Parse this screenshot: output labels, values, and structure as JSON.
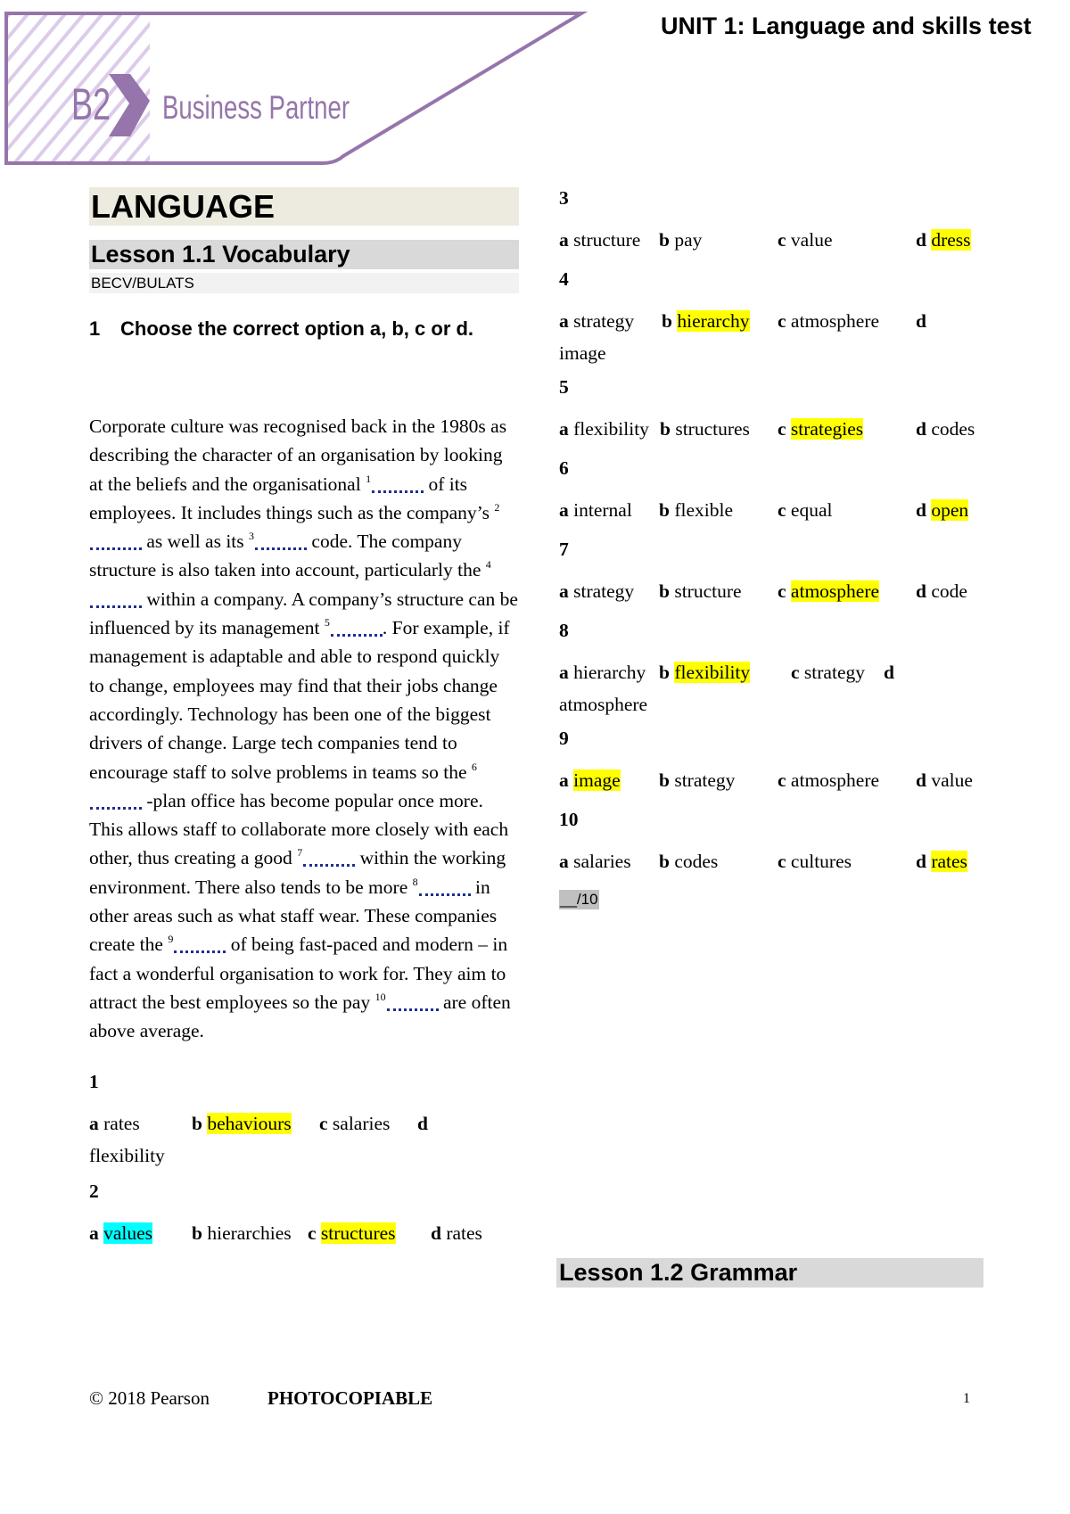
{
  "header": {
    "logo_level": "B2",
    "logo_title": "Business Partner",
    "unit_title": "UNIT 1: Language and skills test",
    "brand_color": "#9575ab",
    "stripe_color": "#dcccea"
  },
  "section": {
    "title": "LANGUAGE",
    "lesson_title": "Lesson 1.1 Vocabulary",
    "exam_tag": "BECV/BULATS",
    "exercise_number": "1",
    "instruction": "Choose the correct option a, b, c or d."
  },
  "passage": {
    "segments": [
      {
        "text": "Corporate culture was recognised back in the 1980s as describing the character of an organisation by looking at the beliefs and the organisational "
      },
      {
        "gap": "1"
      },
      {
        "text": " of its employees. It includes things such as the company’s "
      },
      {
        "gap": "2"
      },
      {
        "text": " as well as its "
      },
      {
        "gap": "3"
      },
      {
        "text": " code. The company structure is also taken into account, particularly the "
      },
      {
        "gap": "4"
      },
      {
        "text": " within a company. A company’s structure can be influenced by its management "
      },
      {
        "gap": "5"
      },
      {
        "text": ". For example, if management is adaptable and able to respond quickly to change, employees may find that their jobs change accordingly. Technology has been one of the biggest drivers of change. Large tech companies tend to encourage staff to solve problems in teams so the "
      },
      {
        "gap": "6"
      },
      {
        "text": " -plan office has become popular once more. This allows staff to collaborate more closely with each other, thus creating a good "
      },
      {
        "gap": "7"
      },
      {
        "text": " within the working environment. There also tends to be more "
      },
      {
        "gap": "8"
      },
      {
        "text": " in other areas such as what staff wear. These companies create the "
      },
      {
        "gap": "9"
      },
      {
        "text": " of being fast-paced and modern – in fact a wonderful organisation to work for. They aim to attract the best employees so the pay "
      },
      {
        "gap": "10"
      },
      {
        "text": " are often above average."
      }
    ]
  },
  "questions": [
    {
      "number": "1",
      "options": [
        {
          "letter": "a",
          "text": "rates",
          "highlight": ""
        },
        {
          "letter": "b",
          "text": "behaviours",
          "highlight": "yellow"
        },
        {
          "letter": "c",
          "text": "salaries",
          "highlight": ""
        },
        {
          "letter": "d",
          "text": "flexibility",
          "highlight": ""
        }
      ]
    },
    {
      "number": "2",
      "options": [
        {
          "letter": "a",
          "text": "values",
          "highlight": "cyan"
        },
        {
          "letter": "b",
          "text": "hierarchies",
          "highlight": ""
        },
        {
          "letter": "c",
          "text": "structures",
          "highlight": "yellow"
        },
        {
          "letter": "d",
          "text": "rates",
          "highlight": ""
        }
      ]
    },
    {
      "number": "3",
      "options": [
        {
          "letter": "a",
          "text": "structure",
          "highlight": ""
        },
        {
          "letter": "b",
          "text": "pay",
          "highlight": ""
        },
        {
          "letter": "c",
          "text": "value",
          "highlight": ""
        },
        {
          "letter": "d",
          "text": "dress",
          "highlight": "yellow"
        }
      ]
    },
    {
      "number": "4",
      "options": [
        {
          "letter": "a",
          "text": "strategy",
          "highlight": ""
        },
        {
          "letter": "b",
          "text": "hierarchy",
          "highlight": "yellow"
        },
        {
          "letter": "c",
          "text": "atmosphere",
          "highlight": ""
        },
        {
          "letter": "d",
          "text": "image",
          "highlight": ""
        }
      ]
    },
    {
      "number": "5",
      "options": [
        {
          "letter": "a",
          "text": "flexibility",
          "highlight": ""
        },
        {
          "letter": "b",
          "text": "structures",
          "highlight": ""
        },
        {
          "letter": "c",
          "text": "strategies",
          "highlight": "yellow"
        },
        {
          "letter": "d",
          "text": "codes",
          "highlight": ""
        }
      ]
    },
    {
      "number": "6",
      "options": [
        {
          "letter": "a",
          "text": "internal",
          "highlight": ""
        },
        {
          "letter": "b",
          "text": "flexible",
          "highlight": ""
        },
        {
          "letter": "c",
          "text": "equal",
          "highlight": ""
        },
        {
          "letter": "d",
          "text": "open",
          "highlight": "yellow"
        }
      ]
    },
    {
      "number": "7",
      "options": [
        {
          "letter": "a",
          "text": "strategy",
          "highlight": ""
        },
        {
          "letter": "b",
          "text": "structure",
          "highlight": ""
        },
        {
          "letter": "c",
          "text": "atmosphere",
          "highlight": "yellow"
        },
        {
          "letter": "d",
          "text": "code",
          "highlight": ""
        }
      ]
    },
    {
      "number": "8",
      "options": [
        {
          "letter": "a",
          "text": "hierarchy",
          "highlight": ""
        },
        {
          "letter": "b",
          "text": "flexibility",
          "highlight": "yellow"
        },
        {
          "letter": "c",
          "text": "strategy",
          "highlight": ""
        },
        {
          "letter": "d",
          "text": "atmosphere",
          "highlight": ""
        }
      ]
    },
    {
      "number": "9",
      "options": [
        {
          "letter": "a",
          "text": "image",
          "highlight": "yellow"
        },
        {
          "letter": "b",
          "text": "strategy",
          "highlight": ""
        },
        {
          "letter": "c",
          "text": "atmosphere",
          "highlight": ""
        },
        {
          "letter": "d",
          "text": "value",
          "highlight": ""
        }
      ]
    },
    {
      "number": "10",
      "options": [
        {
          "letter": "a",
          "text": "salaries",
          "highlight": ""
        },
        {
          "letter": "b",
          "text": "codes",
          "highlight": ""
        },
        {
          "letter": "c",
          "text": "cultures",
          "highlight": ""
        },
        {
          "letter": "d",
          "text": "rates",
          "highlight": "yellow"
        }
      ]
    }
  ],
  "score": "__/10",
  "next_lesson_title": "Lesson 1.2 Grammar",
  "footer": {
    "copyright": "© 2018 Pearson",
    "photocopiable": "PHOTOCOPIABLE",
    "page_number": "1"
  }
}
